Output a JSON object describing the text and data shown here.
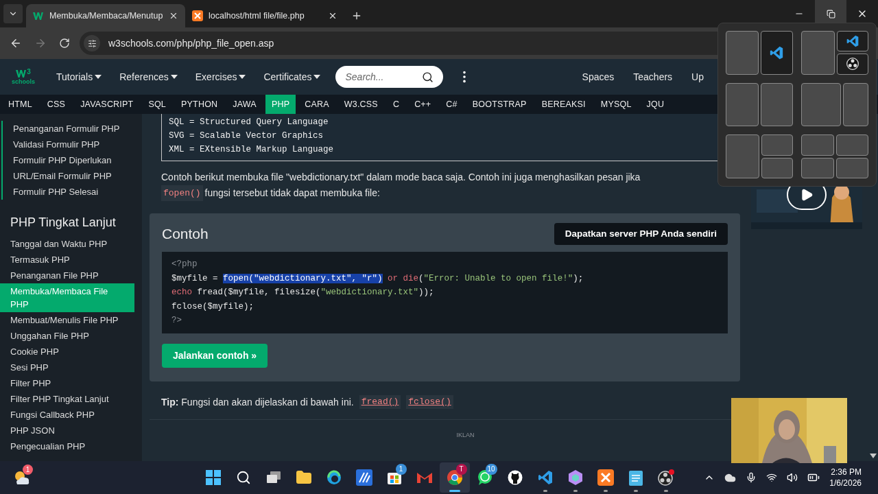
{
  "browser_tabs": [
    {
      "title": "Membuka/Membaca/Menutup",
      "kind": "w3",
      "selected": true
    },
    {
      "title": "localhost/html file/file.php",
      "kind": "xampp",
      "selected": false
    }
  ],
  "address": "w3schools.com/php/php_file_open.asp",
  "site": {
    "logo_sup": "3",
    "logo_text": "schools",
    "menu": [
      {
        "label": "Tutorials"
      },
      {
        "label": "References"
      },
      {
        "label": "Exercises"
      },
      {
        "label": "Certificates"
      }
    ],
    "search_placeholder": "Search...",
    "right_links": [
      "Spaces",
      "Teachers",
      "Up"
    ],
    "topics": [
      {
        "label": "HTML",
        "selected": false
      },
      {
        "label": "CSS",
        "selected": false
      },
      {
        "label": "JAVASCRIPT",
        "selected": false
      },
      {
        "label": "SQL",
        "selected": false
      },
      {
        "label": "PYTHON",
        "selected": false
      },
      {
        "label": "JAWA",
        "selected": false
      },
      {
        "label": "PHP",
        "selected": true
      },
      {
        "label": "CARA",
        "selected": false
      },
      {
        "label": "W3.CSS",
        "selected": false
      },
      {
        "label": "C",
        "selected": false
      },
      {
        "label": "C++",
        "selected": false
      },
      {
        "label": "C#",
        "selected": false
      },
      {
        "label": "BOOTSTRAP",
        "selected": false
      },
      {
        "label": "BEREAKSI",
        "selected": false
      },
      {
        "label": "MYSQL",
        "selected": false
      },
      {
        "label": "JQU",
        "selected": false
      }
    ]
  },
  "sidebar": {
    "group1": [
      {
        "label": "Penanganan Formulir PHP",
        "selected": false
      },
      {
        "label": "Validasi Formulir PHP",
        "selected": false
      },
      {
        "label": "Formulir PHP Diperlukan",
        "selected": false
      },
      {
        "label": "URL/Email Formulir PHP",
        "selected": false
      },
      {
        "label": "Formulir PHP Selesai",
        "selected": false
      }
    ],
    "heading": "PHP Tingkat Lanjut",
    "group2": [
      {
        "label": "Tanggal dan Waktu PHP",
        "selected": false
      },
      {
        "label": "Termasuk PHP",
        "selected": false
      },
      {
        "label": "Penanganan File PHP",
        "selected": false
      },
      {
        "label": "Membuka/Membaca File PHP",
        "selected": true
      },
      {
        "label": "Membuat/Menulis File PHP",
        "selected": false
      },
      {
        "label": "Unggahan File PHP",
        "selected": false
      },
      {
        "label": "Cookie PHP",
        "selected": false
      },
      {
        "label": "Sesi PHP",
        "selected": false
      },
      {
        "label": "Filter PHP",
        "selected": false
      },
      {
        "label": "Filter PHP Tingkat Lanjut",
        "selected": false
      },
      {
        "label": "Fungsi Callback PHP",
        "selected": false
      },
      {
        "label": "PHP JSON",
        "selected": false
      },
      {
        "label": "Pengecualian PHP",
        "selected": false
      }
    ]
  },
  "content": {
    "pre_lines": [
      "SQL = Structured Query Language",
      "SVG = Scalable Vector Graphics",
      "XML = EXtensible Markup Language"
    ],
    "intro": {
      "text": "Contoh berikut membuka file \"webdictionary.txt\" dalam mode baca saja. Contoh ini juga menghasilkan pesan jika",
      "code": "fopen()",
      "after": "fungsi tersebut tidak dapat membuka file:"
    },
    "example": {
      "title": "Contoh",
      "server_button": "Dapatkan server PHP Anda sendiri",
      "code": [
        [
          {
            "kind": "tag",
            "text": "<?php"
          }
        ],
        [
          {
            "kind": "plain",
            "text": "$myfile = "
          },
          {
            "kind": "selected",
            "text": "fopen(\"webdictionary.txt\", \"r\")"
          },
          {
            "kind": "keyword",
            "text": " or die"
          },
          {
            "kind": "plain",
            "text": "("
          },
          {
            "kind": "string",
            "text": "\"Error: Unable to open file!\""
          },
          {
            "kind": "plain",
            "text": ");"
          }
        ],
        [
          {
            "kind": "keyword",
            "text": "echo"
          },
          {
            "kind": "plain",
            "text": " fread($myfile, filesize("
          },
          {
            "kind": "string",
            "text": "\"webdictionary.txt\""
          },
          {
            "kind": "plain",
            "text": "));"
          }
        ],
        [
          {
            "kind": "plain",
            "text": "fclose($myfile);"
          }
        ],
        [
          {
            "kind": "tag",
            "text": "?>"
          }
        ]
      ],
      "run_button": "Jalankan contoh »"
    },
    "tip": "**Tip:** Fungsi dan akan dijelaskan di bawah ini.",
    "tip_links": [
      "fread()",
      "fclose()"
    ],
    "ad_label": "IKLAN"
  },
  "taskbar": {
    "weather_badge": "1",
    "apps": [
      {
        "kind": "start",
        "running": false,
        "active": false
      },
      {
        "kind": "search",
        "running": false,
        "active": false
      },
      {
        "kind": "taskview",
        "running": false,
        "active": false
      },
      {
        "kind": "explorer",
        "running": false,
        "active": false
      },
      {
        "kind": "edge",
        "running": false,
        "active": false
      },
      {
        "kind": "pen",
        "running": false,
        "active": false
      },
      {
        "kind": "store",
        "badge": "1",
        "running": false,
        "active": false
      },
      {
        "kind": "gmail",
        "running": false,
        "active": false
      },
      {
        "kind": "chrome",
        "badge": "T",
        "running": true,
        "active": true
      },
      {
        "kind": "whatsapp",
        "badge": "10",
        "running": false,
        "active": false
      },
      {
        "kind": "github",
        "running": false,
        "active": false
      },
      {
        "kind": "vscode",
        "running": true,
        "active": false
      },
      {
        "kind": "cube",
        "running": true,
        "active": false
      },
      {
        "kind": "xampp",
        "running": true,
        "active": false
      },
      {
        "kind": "notepad",
        "running": true,
        "active": false
      },
      {
        "kind": "obs",
        "running": true,
        "active": false
      }
    ],
    "time": "2:36 PM",
    "date": "1/6/2026"
  }
}
